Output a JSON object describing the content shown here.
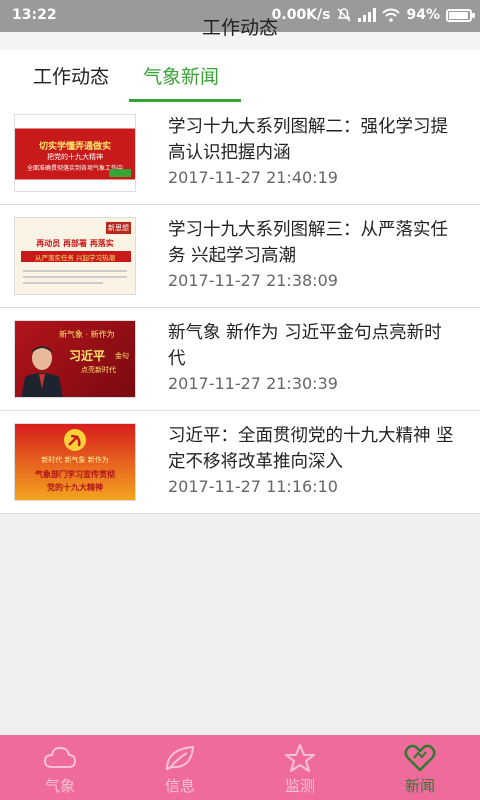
{
  "status_bar": {
    "time": "13:22",
    "net_speed": "0.00K/s",
    "battery": "94%",
    "battery_level": 0.94
  },
  "app": {
    "title": "工作动态"
  },
  "tabs": [
    {
      "label": "工作动态",
      "active": false
    },
    {
      "label": "气象新闻",
      "active": true
    }
  ],
  "news": [
    {
      "title": "学习十九大系列图解二：强化学习提高认识把握内涵",
      "time": "2017-11-27 21:40:19",
      "thumb_lines": [
        "切实学懂弄通做实",
        "把党的十九大精神",
        "全面准确贯彻落实到各项气象工作中"
      ]
    },
    {
      "title": "学习十九大系列图解三：从严落实任务 兴起学习高潮",
      "time": "2017-11-27 21:38:09",
      "thumb_lines": [
        "新思想",
        "再动员 再部署 再落实",
        "从严落实任务 兴起学习热潮"
      ]
    },
    {
      "title": "新气象 新作为 习近平金句点亮新时代",
      "time": "2017-11-27 21:30:39",
      "thumb_lines": [
        "新气象 · 新作为",
        "习近平",
        "金句",
        "点亮新时代"
      ]
    },
    {
      "title": "习近平：全面贯彻党的十九大精神 坚定不移将改革推向深入",
      "time": "2017-11-27 11:16:10",
      "thumb_lines": [
        "新时代 新气象 新作为",
        "气象部门学习宣传贯彻",
        "党的十九大精神"
      ]
    }
  ],
  "nav": [
    {
      "label": "气象",
      "icon": "cloud-icon",
      "active": false
    },
    {
      "label": "信息",
      "icon": "leaf-icon",
      "active": false
    },
    {
      "label": "监测",
      "icon": "star-icon",
      "active": false
    },
    {
      "label": "新闻",
      "icon": "heart-icon",
      "active": true
    }
  ],
  "colors": {
    "accent": "#3aa336",
    "nav_bg": "#ee6b9b",
    "nav_active": "#2f7a2f"
  }
}
